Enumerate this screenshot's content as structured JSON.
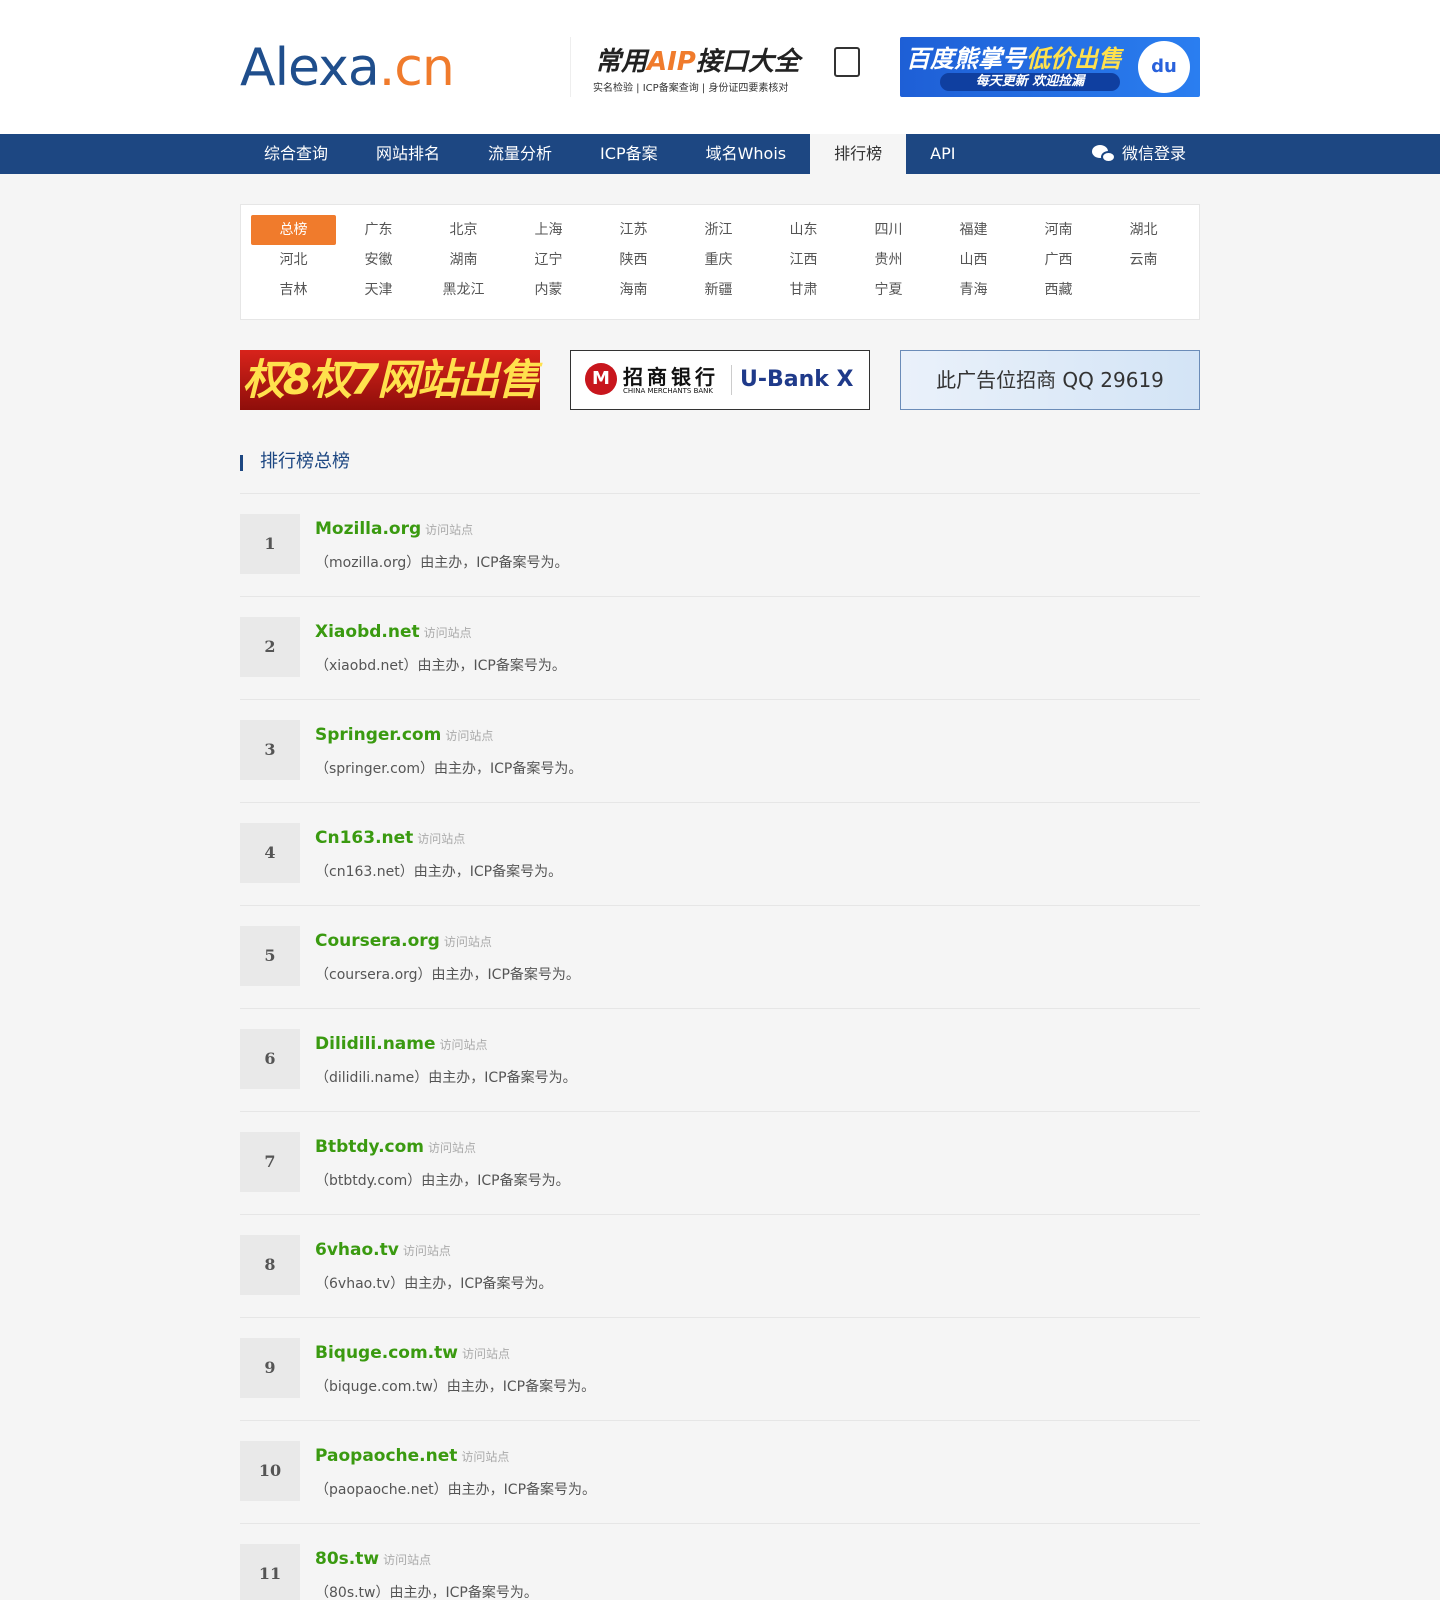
{
  "header": {
    "logo_main": "Alexa",
    "logo_ext": ".cn",
    "ad_aip": {
      "title_pre": "常用",
      "title_hl": "AIP",
      "title_post": "接口大全",
      "sub": "实名检验 | ICP备案查询 | 身份证四要素核对"
    },
    "ad_baidu": {
      "title_pre": "百度熊掌号",
      "title_hl": "低价出售",
      "sub": "每天更新 欢迎捡漏",
      "paw": "du"
    }
  },
  "nav": {
    "items": [
      {
        "label": "综合查询",
        "active": false
      },
      {
        "label": "网站排名",
        "active": false
      },
      {
        "label": "流量分析",
        "active": false
      },
      {
        "label": "ICP备案",
        "active": false
      },
      {
        "label": "域名Whois",
        "active": false
      },
      {
        "label": "排行榜",
        "active": true
      },
      {
        "label": "API",
        "active": false
      }
    ],
    "login": "微信登录"
  },
  "regions": [
    "总榜",
    "广东",
    "北京",
    "上海",
    "江苏",
    "浙江",
    "山东",
    "四川",
    "福建",
    "河南",
    "湖北",
    "河北",
    "安徽",
    "湖南",
    "辽宁",
    "陕西",
    "重庆",
    "江西",
    "贵州",
    "山西",
    "广西",
    "云南",
    "吉林",
    "天津",
    "黑龙江",
    "内蒙",
    "海南",
    "新疆",
    "甘肃",
    "宁夏",
    "青海",
    "西藏"
  ],
  "ads": {
    "red": "权8权7网站出售",
    "cmb_logo": "M",
    "cmb_cn": "招商银行",
    "cmb_en": "CHINA MERCHANTS BANK",
    "cmb_ubank": "U-Bank X",
    "qq": "此广告位招商 QQ 29619"
  },
  "section_title": "排行榜总榜",
  "visit_label": "访问站点",
  "ranking": [
    {
      "rank": "1",
      "name": "Mozilla.org",
      "desc": "（mozilla.org）由主办，ICP备案号为。"
    },
    {
      "rank": "2",
      "name": "Xiaobd.net",
      "desc": "（xiaobd.net）由主办，ICP备案号为。"
    },
    {
      "rank": "3",
      "name": "Springer.com",
      "desc": "（springer.com）由主办，ICP备案号为。"
    },
    {
      "rank": "4",
      "name": "Cn163.net",
      "desc": "（cn163.net）由主办，ICP备案号为。"
    },
    {
      "rank": "5",
      "name": "Coursera.org",
      "desc": "（coursera.org）由主办，ICP备案号为。"
    },
    {
      "rank": "6",
      "name": "Dilidili.name",
      "desc": "（dilidili.name）由主办，ICP备案号为。"
    },
    {
      "rank": "7",
      "name": "Btbtdy.com",
      "desc": "（btbtdy.com）由主办，ICP备案号为。"
    },
    {
      "rank": "8",
      "name": "6vhao.tv",
      "desc": "（6vhao.tv）由主办，ICP备案号为。"
    },
    {
      "rank": "9",
      "name": "Biquge.com.tw",
      "desc": "（biquge.com.tw）由主办，ICP备案号为。"
    },
    {
      "rank": "10",
      "name": "Paopaoche.net",
      "desc": "（paopaoche.net）由主办，ICP备案号为。"
    },
    {
      "rank": "11",
      "name": "80s.tw",
      "desc": "（80s.tw）由主办，ICP备案号为。"
    }
  ]
}
